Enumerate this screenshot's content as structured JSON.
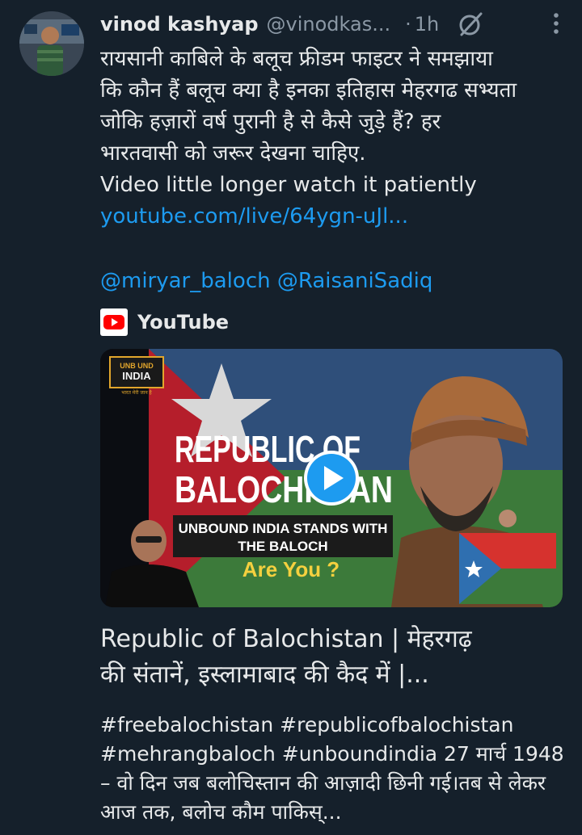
{
  "author": {
    "name": "vinod kashyap",
    "handle": "@vinodkas...",
    "separator": "·",
    "time": "1h"
  },
  "tweet": {
    "lines": [
      "रायसानी काबिले के बलूच फ्रीडम फाइटर ने समझाया",
      "कि कौन हैं बलूच क्या है इनका इतिहास मेहरगढ सभ्यता",
      "जोकि हज़ारों वर्ष पुरानी है से कैसे जुड़े हैं? हर",
      "भारतवासी को जरूर देखना चाहिए.",
      "Video little longer watch it patiently"
    ],
    "link": "youtube.com/live/64ygn-uJl...",
    "mentions": "@miryar_baloch @RaisaniSadiq"
  },
  "card": {
    "source": "YouTube",
    "thumbnail": {
      "channel_logo_top": "UNB UND",
      "channel_logo_main": "INDIA",
      "channel_logo_sub": "भारत मेरी जान है",
      "headline_1": "REPUBLIC OF",
      "headline_2": "BALOCHISTAN",
      "banner_1": "UNBOUND INDIA STANDS WITH",
      "banner_2": "THE BALOCH",
      "question": "Are You ?"
    },
    "title_lines": [
      "Republic of Balochistan | मेहरगढ़",
      "की संतानें, इस्लामाबाद की कैद में |..."
    ],
    "description_lines": [
      "#freebalochistan #republicofbalochistan",
      "#mehrangbaloch #unboundindia 27 मार्च 1948",
      "– वो दिन जब बलोचिस्तान की आज़ादी छिनी गई।तब से लेकर",
      "आज तक, बलोच कौम पाकिस्..."
    ]
  },
  "colors": {
    "background": "#15202b",
    "text": "#e7e9ea",
    "secondary": "#8b98a5",
    "link": "#1d9bf0",
    "youtube_red": "#ff0000",
    "play_button": "#1d9bf0"
  },
  "icons": [
    "avatar",
    "grok-icon",
    "more-icon",
    "youtube-logo-icon",
    "play-icon"
  ]
}
